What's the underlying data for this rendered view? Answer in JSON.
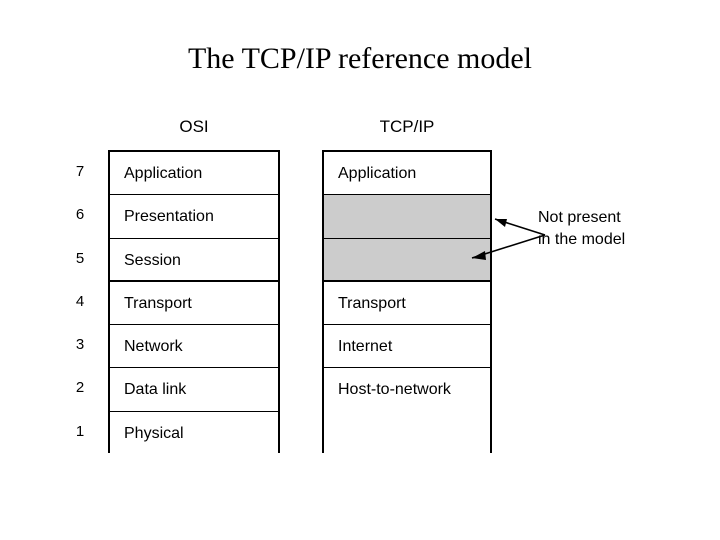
{
  "slide": {
    "title": "The TCP/IP reference model",
    "background_color": "#ffffff",
    "text_color": "#000000",
    "absent_fill_color": "#cccccc"
  },
  "columns": {
    "osi_header": "OSI",
    "tcpip_header": "TCP/IP"
  },
  "layer_numbers": [
    "7",
    "6",
    "5",
    "4",
    "3",
    "2",
    "1"
  ],
  "osi_layers": [
    {
      "number": "7",
      "name": "Application"
    },
    {
      "number": "6",
      "name": "Presentation"
    },
    {
      "number": "5",
      "name": "Session"
    },
    {
      "number": "4",
      "name": "Transport"
    },
    {
      "number": "3",
      "name": "Network"
    },
    {
      "number": "2",
      "name": "Data link"
    },
    {
      "number": "1",
      "name": "Physical"
    }
  ],
  "tcpip_layers": [
    {
      "name": "Application",
      "present": true
    },
    {
      "name": "",
      "present": false
    },
    {
      "name": "",
      "present": false
    },
    {
      "name": "Transport",
      "present": true
    },
    {
      "name": "Internet",
      "present": true
    },
    {
      "name": "Host-to-network",
      "present": true,
      "spans": 2
    }
  ],
  "callout": {
    "line1": "Not present",
    "line2": "in the model"
  }
}
